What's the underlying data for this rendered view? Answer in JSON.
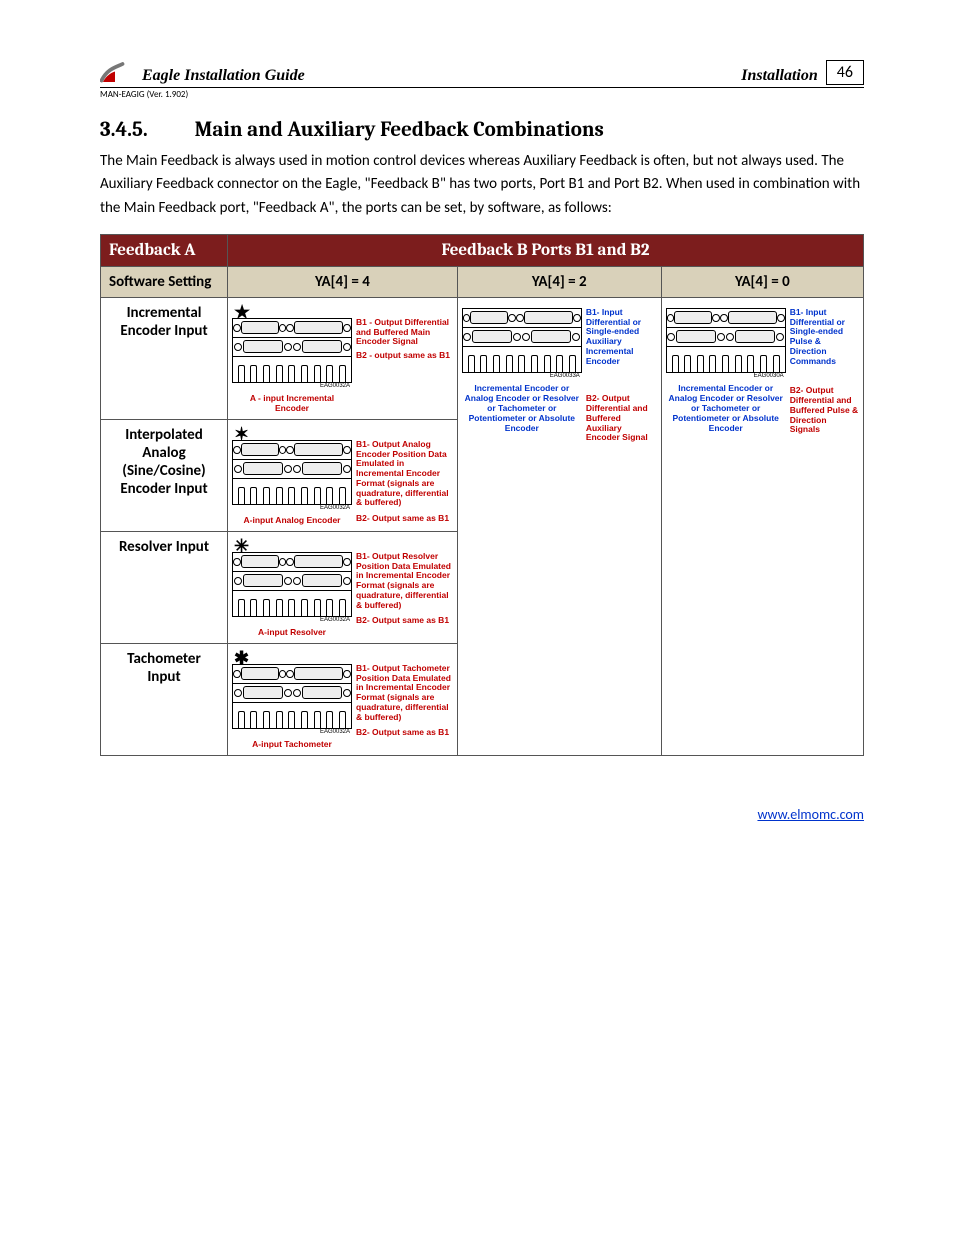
{
  "header": {
    "doc_title": "Eagle Installation Guide",
    "section": "Installation",
    "page_number": "46",
    "man_code": "MAN-EAGIG (Ver. 1.902)"
  },
  "heading": {
    "number": "3.4.5.",
    "title": "Main and Auxiliary Feedback Combinations"
  },
  "intro": "The Main Feedback is always used in motion control devices whereas Auxiliary Feedback is often, but not always used. The Auxiliary Feedback connector on the Eagle, \"Feedback B\" has two ports, Port B1 and Port B2. When used in combination with the Main Feedback port, \"Feedback A\", the ports can be set, by software, as follows:",
  "table": {
    "head_a": "Feedback A",
    "head_b": "Feedback B Ports B1 and B2",
    "sw_setting": "Software Setting",
    "ya4_4": "YA[4] = 4",
    "ya4_2": "YA[4] = 2",
    "ya4_0": "YA[4] = 0",
    "rows": {
      "r1": "Incremental Encoder Input",
      "r2": "Interpolated Analog (Sine/Cosine) Encoder Input",
      "r3": "Resolver Input",
      "r4": "Tachometer Input"
    }
  },
  "markers": {
    "star5": "★",
    "star6": "✶",
    "star8a": "✳",
    "star8b": "✱"
  },
  "diagrams": {
    "part_codes": {
      "a": "EAG0032A",
      "b": "EAG0033A",
      "c": "EAG0030A"
    },
    "ya4": {
      "inc": {
        "b1": "B1 - Output Differential and Buffered Main Encoder Signal",
        "b2": "B2 - output same as B1",
        "a": "A - input Incremental Encoder"
      },
      "analog": {
        "b1": "B1- Output Analog Encoder Position Data Emulated in Incremental Encoder Format (signals are quadrature, differential & buffered)",
        "b2": "B2- Output same as B1",
        "a": "A-input Analog Encoder"
      },
      "resolver": {
        "b1": "B1- Output Resolver Position Data Emulated in Incremental Encoder Format (signals are quadrature, differential & buffered)",
        "b2": "B2- Output same as B1",
        "a": "A-input Resolver"
      },
      "tach": {
        "b1": "B1- Output Tachometer Position Data Emulated in Incremental Encoder Format (signals are quadrature, differential & buffered)",
        "b2": "B2- Output same as B1",
        "a": "A-input Tachometer"
      }
    },
    "ya2": {
      "b1": "B1- Input Differential or Single-ended Auxiliary Incremental Encoder",
      "b2": "B2- Output Differential and Buffered Auxiliary Encoder Signal",
      "a": "Incremental Encoder or Analog Encoder or Resolver or Tachometer or Potentiometer or Absolute Encoder"
    },
    "ya0": {
      "b1": "B1- Input Differential or Single-ended Pulse & Direction Commands",
      "b2": "B2- Output Differential and Buffered Pulse & Direction Signals",
      "a": "Incremental Encoder or Analog Encoder or Resolver or Tachometer or Potentiometer or Absolute Encoder"
    }
  },
  "footer_url": "www.elmomc.com"
}
